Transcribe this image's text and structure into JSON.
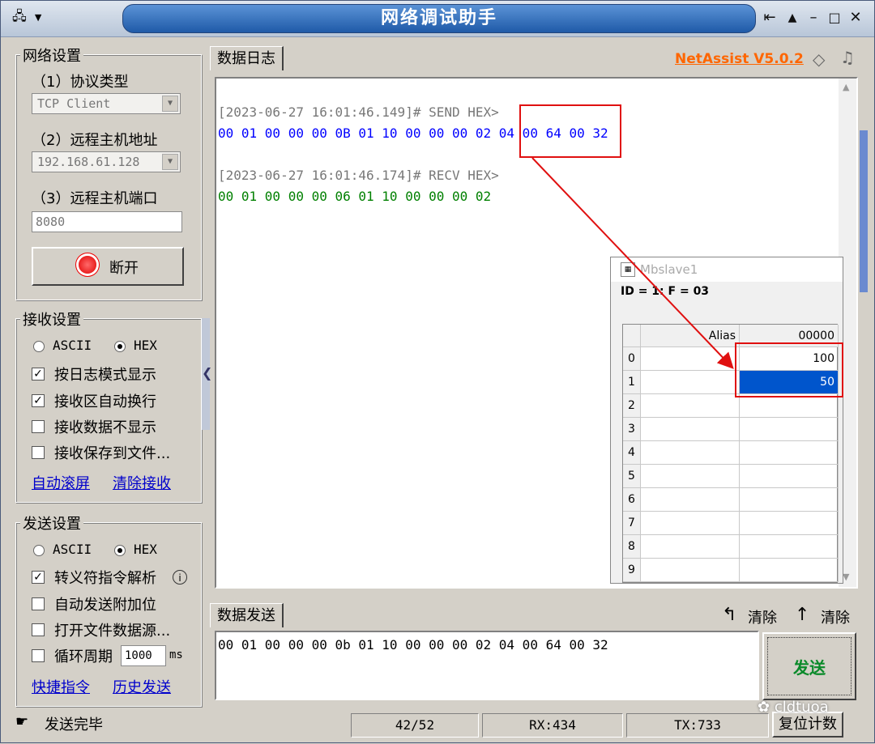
{
  "app": {
    "title": "网络调试助手",
    "brand_link": "NetAssist V5.0.2"
  },
  "network": {
    "group_title": "网络设置",
    "protocol_label": "（1）协议类型",
    "protocol_value": "TCP Client",
    "host_label": "（2）远程主机地址",
    "host_value": "192.168.61.128",
    "port_label": "（3）远程主机端口",
    "port_value": "8080",
    "disconnect_label": "断开"
  },
  "receive": {
    "group_title": "接收设置",
    "ascii_label": "ASCII",
    "hex_label": "HEX",
    "mode": "HEX",
    "options": [
      {
        "label": "按日志模式显示",
        "checked": true
      },
      {
        "label": "接收区自动换行",
        "checked": true
      },
      {
        "label": "接收数据不显示",
        "checked": false
      },
      {
        "label": "接收保存到文件...",
        "checked": false
      }
    ],
    "auto_scroll_link": "自动滚屏",
    "clear_link": "清除接收"
  },
  "send_settings": {
    "group_title": "发送设置",
    "ascii_label": "ASCII",
    "hex_label": "HEX",
    "mode": "HEX",
    "options": [
      {
        "label": "转义符指令解析",
        "checked": true
      },
      {
        "label": "自动发送附加位",
        "checked": false
      },
      {
        "label": "打开文件数据源...",
        "checked": false
      }
    ],
    "cycle_label": "循环周期",
    "cycle_value": "1000",
    "cycle_unit": "ms",
    "shortcut_link": "快捷指令",
    "history_link": "历史发送"
  },
  "log": {
    "tab_label": "数据日志",
    "entries": [
      {
        "header": "[2023-06-27 16:01:46.149]# SEND HEX>",
        "data": "00 01 00 00 00 0B 01 10 00 00 00 02 04 00 64 00 32",
        "kind": "send"
      },
      {
        "header": "[2023-06-27 16:01:46.174]# RECV HEX>",
        "data": "00 01 00 00 00 06 01 10 00 00 00 02",
        "kind": "recv"
      }
    ]
  },
  "mbslave": {
    "title": "Mbslave1",
    "info": "ID = 1: F = 03",
    "col_alias": "Alias",
    "col_addr": "00000",
    "rows": [
      {
        "idx": "0",
        "value": "100"
      },
      {
        "idx": "1",
        "value": "50"
      },
      {
        "idx": "2",
        "value": ""
      },
      {
        "idx": "3",
        "value": ""
      },
      {
        "idx": "4",
        "value": ""
      },
      {
        "idx": "5",
        "value": ""
      },
      {
        "idx": "6",
        "value": ""
      },
      {
        "idx": "7",
        "value": ""
      },
      {
        "idx": "8",
        "value": ""
      },
      {
        "idx": "9",
        "value": ""
      }
    ]
  },
  "send": {
    "tab_label": "数据发送",
    "clear1": "清除",
    "clear2": "清除",
    "input_value": "00 01 00 00 00 0b 01 10 00 00 00 02 04 00 64 00 32",
    "send_button": "发送"
  },
  "status": {
    "message": "发送完毕",
    "count": "42/52",
    "rx": "RX:434",
    "tx": "TX:733",
    "reset": "复位计数",
    "watermark": "cldtuoa"
  },
  "colors": {
    "send": "#0000ff",
    "recv": "#008000",
    "highlight": "#e01010",
    "selected": "#0055cc",
    "brand": "#ff6600"
  }
}
